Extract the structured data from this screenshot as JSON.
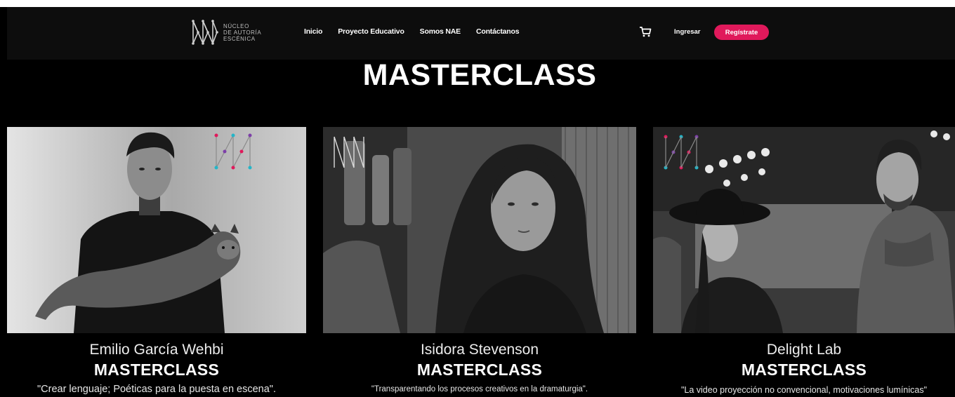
{
  "brand": {
    "logo_lines": [
      "NÚCLEO",
      "DE AUTORÍA",
      "ESCÉNICA"
    ]
  },
  "nav": {
    "links": [
      "Inicio",
      "Proyecto Educativo",
      "Somos NAE",
      "Contáctanos"
    ],
    "cart_icon": "shopping-cart-icon",
    "login_label": "Ingresar",
    "register_label": "Regístrate"
  },
  "page": {
    "title": "MASTERCLASS"
  },
  "cards": [
    {
      "name": "Emilio García Wehbi",
      "tag": "MASTERCLASS",
      "quote": "\"Crear lenguaje; Poéticas para la puesta en escena\"."
    },
    {
      "name": "Isidora Stevenson",
      "tag": "MASTERCLASS",
      "quote": "\"Transparentando los procesos creativos en la dramaturgia\"."
    },
    {
      "name": "Delight Lab",
      "tag": "MASTERCLASS",
      "quote": "\"La video proyección no convencional, motivaciones lumínicas\""
    }
  ],
  "colors": {
    "accent": "#e0195b",
    "background": "#000000",
    "nav_background": "#0d0d0d"
  }
}
